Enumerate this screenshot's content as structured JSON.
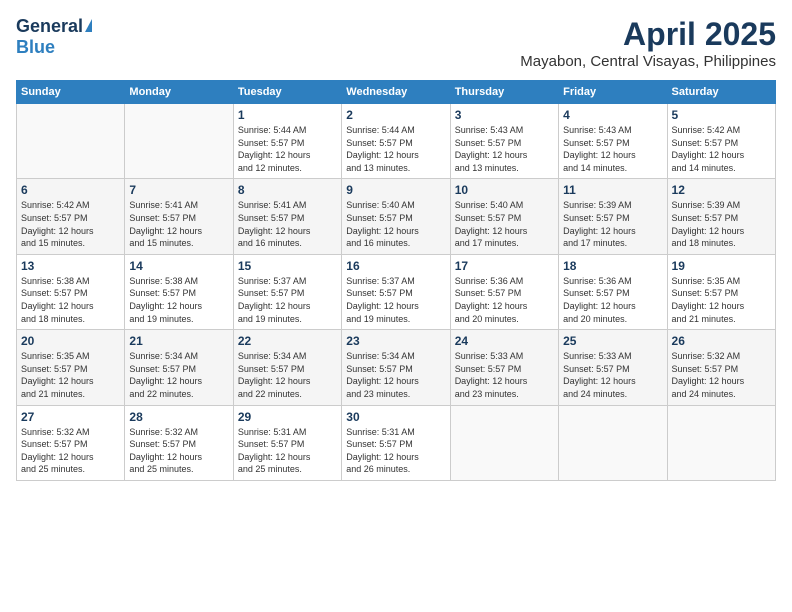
{
  "header": {
    "logo_general": "General",
    "logo_blue": "Blue",
    "month_year": "April 2025",
    "location": "Mayabon, Central Visayas, Philippines"
  },
  "days_of_week": [
    "Sunday",
    "Monday",
    "Tuesday",
    "Wednesday",
    "Thursday",
    "Friday",
    "Saturday"
  ],
  "weeks": [
    [
      {
        "day": "",
        "info": ""
      },
      {
        "day": "",
        "info": ""
      },
      {
        "day": "1",
        "info": "Sunrise: 5:44 AM\nSunset: 5:57 PM\nDaylight: 12 hours\nand 12 minutes."
      },
      {
        "day": "2",
        "info": "Sunrise: 5:44 AM\nSunset: 5:57 PM\nDaylight: 12 hours\nand 13 minutes."
      },
      {
        "day": "3",
        "info": "Sunrise: 5:43 AM\nSunset: 5:57 PM\nDaylight: 12 hours\nand 13 minutes."
      },
      {
        "day": "4",
        "info": "Sunrise: 5:43 AM\nSunset: 5:57 PM\nDaylight: 12 hours\nand 14 minutes."
      },
      {
        "day": "5",
        "info": "Sunrise: 5:42 AM\nSunset: 5:57 PM\nDaylight: 12 hours\nand 14 minutes."
      }
    ],
    [
      {
        "day": "6",
        "info": "Sunrise: 5:42 AM\nSunset: 5:57 PM\nDaylight: 12 hours\nand 15 minutes."
      },
      {
        "day": "7",
        "info": "Sunrise: 5:41 AM\nSunset: 5:57 PM\nDaylight: 12 hours\nand 15 minutes."
      },
      {
        "day": "8",
        "info": "Sunrise: 5:41 AM\nSunset: 5:57 PM\nDaylight: 12 hours\nand 16 minutes."
      },
      {
        "day": "9",
        "info": "Sunrise: 5:40 AM\nSunset: 5:57 PM\nDaylight: 12 hours\nand 16 minutes."
      },
      {
        "day": "10",
        "info": "Sunrise: 5:40 AM\nSunset: 5:57 PM\nDaylight: 12 hours\nand 17 minutes."
      },
      {
        "day": "11",
        "info": "Sunrise: 5:39 AM\nSunset: 5:57 PM\nDaylight: 12 hours\nand 17 minutes."
      },
      {
        "day": "12",
        "info": "Sunrise: 5:39 AM\nSunset: 5:57 PM\nDaylight: 12 hours\nand 18 minutes."
      }
    ],
    [
      {
        "day": "13",
        "info": "Sunrise: 5:38 AM\nSunset: 5:57 PM\nDaylight: 12 hours\nand 18 minutes."
      },
      {
        "day": "14",
        "info": "Sunrise: 5:38 AM\nSunset: 5:57 PM\nDaylight: 12 hours\nand 19 minutes."
      },
      {
        "day": "15",
        "info": "Sunrise: 5:37 AM\nSunset: 5:57 PM\nDaylight: 12 hours\nand 19 minutes."
      },
      {
        "day": "16",
        "info": "Sunrise: 5:37 AM\nSunset: 5:57 PM\nDaylight: 12 hours\nand 19 minutes."
      },
      {
        "day": "17",
        "info": "Sunrise: 5:36 AM\nSunset: 5:57 PM\nDaylight: 12 hours\nand 20 minutes."
      },
      {
        "day": "18",
        "info": "Sunrise: 5:36 AM\nSunset: 5:57 PM\nDaylight: 12 hours\nand 20 minutes."
      },
      {
        "day": "19",
        "info": "Sunrise: 5:35 AM\nSunset: 5:57 PM\nDaylight: 12 hours\nand 21 minutes."
      }
    ],
    [
      {
        "day": "20",
        "info": "Sunrise: 5:35 AM\nSunset: 5:57 PM\nDaylight: 12 hours\nand 21 minutes."
      },
      {
        "day": "21",
        "info": "Sunrise: 5:34 AM\nSunset: 5:57 PM\nDaylight: 12 hours\nand 22 minutes."
      },
      {
        "day": "22",
        "info": "Sunrise: 5:34 AM\nSunset: 5:57 PM\nDaylight: 12 hours\nand 22 minutes."
      },
      {
        "day": "23",
        "info": "Sunrise: 5:34 AM\nSunset: 5:57 PM\nDaylight: 12 hours\nand 23 minutes."
      },
      {
        "day": "24",
        "info": "Sunrise: 5:33 AM\nSunset: 5:57 PM\nDaylight: 12 hours\nand 23 minutes."
      },
      {
        "day": "25",
        "info": "Sunrise: 5:33 AM\nSunset: 5:57 PM\nDaylight: 12 hours\nand 24 minutes."
      },
      {
        "day": "26",
        "info": "Sunrise: 5:32 AM\nSunset: 5:57 PM\nDaylight: 12 hours\nand 24 minutes."
      }
    ],
    [
      {
        "day": "27",
        "info": "Sunrise: 5:32 AM\nSunset: 5:57 PM\nDaylight: 12 hours\nand 25 minutes."
      },
      {
        "day": "28",
        "info": "Sunrise: 5:32 AM\nSunset: 5:57 PM\nDaylight: 12 hours\nand 25 minutes."
      },
      {
        "day": "29",
        "info": "Sunrise: 5:31 AM\nSunset: 5:57 PM\nDaylight: 12 hours\nand 25 minutes."
      },
      {
        "day": "30",
        "info": "Sunrise: 5:31 AM\nSunset: 5:57 PM\nDaylight: 12 hours\nand 26 minutes."
      },
      {
        "day": "",
        "info": ""
      },
      {
        "day": "",
        "info": ""
      },
      {
        "day": "",
        "info": ""
      }
    ]
  ]
}
